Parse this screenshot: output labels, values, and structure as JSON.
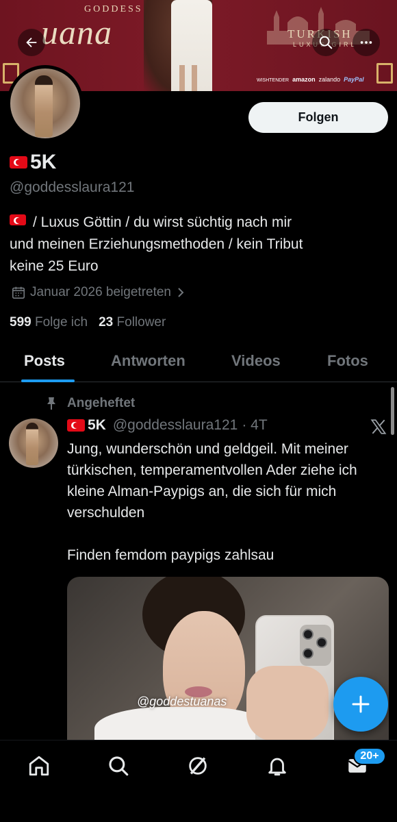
{
  "banner": {
    "brand_small": "GODDESS",
    "brand_big": "uana",
    "turkish": "TURKISH",
    "luxus": "LUXUS GIRL",
    "sponsors": [
      "WISHTENDER",
      "amazon",
      "zalando",
      "PayPal"
    ]
  },
  "header": {
    "back_icon": "arrow-left-icon",
    "search_icon": "search-icon",
    "more_icon": "more-horizontal-icon"
  },
  "profile": {
    "follow_label": "Folgen",
    "display_name": "5K",
    "handle": "@goddesslaura121",
    "bio_lines": [
      "/ Luxus Göttin / du wirst süchtig nach mir",
      "und meinen Erziehungsmethoden / kein Tribut",
      "keine 25 Euro"
    ],
    "joined": "Januar 2026 beigetreten",
    "following_count": "599",
    "following_label": "Folge ich",
    "followers_count": "23",
    "followers_label": "Follower"
  },
  "tabs": [
    "Posts",
    "Antworten",
    "Videos",
    "Fotos"
  ],
  "tweet": {
    "pinned_label": "Angeheftet",
    "name": "5K",
    "handle": "@goddesslaura121",
    "time": "· 4T",
    "text": "Jung, wunderschön und geldgeil. Mit meiner türkischen, temperamentvollen Ader ziehe ich kleine Alman-Paypigs an, die sich für mich verschulden\n\nFinden femdom paypigs zahlsau",
    "image_watermark": "@goddestuanas"
  },
  "bottom_nav": {
    "items": [
      "home-icon",
      "search-icon",
      "grok-icon",
      "notifications-icon",
      "messages-icon"
    ],
    "messages_badge": "20+"
  },
  "colors": {
    "accent": "#1d9bf0",
    "background": "#000000",
    "text_primary": "#e7e9ea",
    "text_secondary": "#71767b",
    "banner": "#7d1a27"
  }
}
